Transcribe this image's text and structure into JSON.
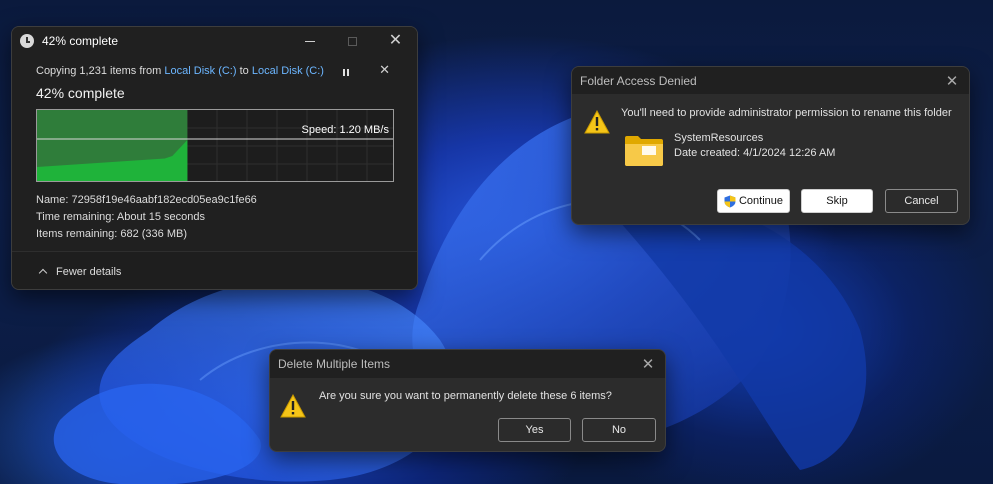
{
  "copy_dialog": {
    "title": "42% complete",
    "line_prefix": "Copying 1,231 items from",
    "source": "Local Disk (C:)",
    "line_to": "to",
    "destination": "Local Disk (C:)",
    "heading": "42% complete",
    "progress_percent": 42,
    "speed": "Speed: 1.20 MB/s",
    "name": "Name: 72958f19e46aabf182ecd05ea9c1fe66",
    "time_remaining": "Time remaining: About 15 seconds",
    "items_remaining": "Items remaining: 682 (336 MB)",
    "fewer_details": "Fewer details"
  },
  "access_dialog": {
    "title": "Folder Access Denied",
    "message": "You'll need to provide administrator permission to rename this folder",
    "folder_name": "SystemResources",
    "date_created": "Date created: 4/1/2024 12:26 AM",
    "continue_label": "Continue",
    "skip_label": "Skip",
    "cancel_label": "Cancel"
  },
  "delete_dialog": {
    "title": "Delete Multiple Items",
    "message": "Are you sure you want to permanently delete these 6 items?",
    "yes_label": "Yes",
    "no_label": "No"
  },
  "colors": {
    "accent_link": "#6cb6ff",
    "progress_green": "#1fb33a",
    "warning_yellow": "#f5c518"
  }
}
